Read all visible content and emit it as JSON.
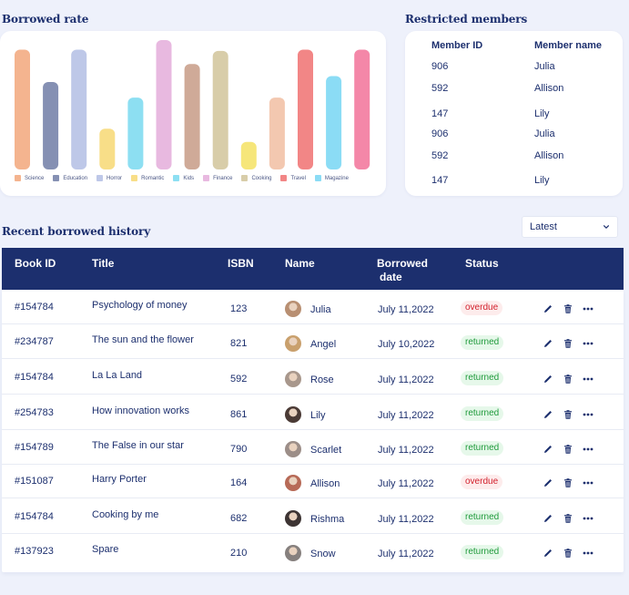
{
  "chart_section": {
    "title": "Borrowed rate"
  },
  "chart_data": {
    "type": "bar",
    "categories": [
      "Science",
      "Education",
      "Horror",
      "Romantic",
      "Kids",
      "Finance",
      "Cooking",
      "Travel",
      "Magazine"
    ],
    "values": [
      100,
      73,
      100,
      34,
      60,
      108,
      88,
      99,
      23,
      60,
      100,
      78,
      100
    ],
    "bar_colors": [
      "#f4b48f",
      "#8590b3",
      "#bec8e8",
      "#f8de88",
      "#8ddff2",
      "#e8b9e0",
      "#cfaa98",
      "#d8cda9",
      "#f6e67a",
      "#f3c8b0",
      "#f28686",
      "#8bdcf5",
      "#f487a8"
    ],
    "legend": [
      {
        "label": "Science",
        "color": "#f4b48f"
      },
      {
        "label": "Education",
        "color": "#8590b3"
      },
      {
        "label": "Horror",
        "color": "#bec8e8"
      },
      {
        "label": "Romantic",
        "color": "#f8de88"
      },
      {
        "label": "Kids",
        "color": "#8ddff2"
      },
      {
        "label": "Finance",
        "color": "#e8b9e0"
      },
      {
        "label": "Cooking",
        "color": "#d8cda9"
      },
      {
        "label": "Travel",
        "color": "#f28686"
      },
      {
        "label": "Magazine",
        "color": "#8bdcf5"
      }
    ],
    "ylim": [
      0,
      108
    ],
    "grid": false,
    "legend_position": "bottom"
  },
  "members": {
    "title": "Restricted members",
    "headers": [
      "Member ID",
      "Member name"
    ],
    "rows": [
      {
        "id": "906",
        "name": "Julia"
      },
      {
        "id": "592",
        "name": "Allison"
      },
      {
        "id": "147",
        "name": "Lily"
      },
      {
        "id": "906",
        "name": "Julia"
      },
      {
        "id": "592",
        "name": "Allison"
      },
      {
        "id": "147",
        "name": "Lily"
      }
    ]
  },
  "history": {
    "title": "Recent borrowed history",
    "sort": {
      "selected": "Latest"
    },
    "headers": {
      "book_id": "Book ID",
      "title": "Title",
      "isbn": "ISBN",
      "name": "Name",
      "borrowed_line1": "Borrowed",
      "borrowed_line2": "date",
      "status": "Status"
    },
    "rows": [
      {
        "book_id": "#154784",
        "title": "Psychology of money",
        "isbn": "123",
        "name": "Julia",
        "date": "July 11,2022",
        "status": "overdue",
        "avatar_color": "#b88f72"
      },
      {
        "book_id": "#234787",
        "title": "The sun and the flower",
        "isbn": "821",
        "name": "Angel",
        "date": "July 10,2022",
        "status": "returned",
        "avatar_color": "#c9a06d"
      },
      {
        "book_id": "#154784",
        "title": "La La Land",
        "isbn": "592",
        "name": "Rose",
        "date": "July 11,2022",
        "status": "returned",
        "avatar_color": "#a8978c"
      },
      {
        "book_id": "#254783",
        "title": "How innovation works",
        "isbn": "861",
        "name": "Lily",
        "date": "July 11,2022",
        "status": "returned",
        "avatar_color": "#4a3a35"
      },
      {
        "book_id": "#154789",
        "title": "The False in our star",
        "isbn": "790",
        "name": "Scarlet",
        "date": "July 11,2022",
        "status": "returned",
        "avatar_color": "#9c8e88"
      },
      {
        "book_id": "#151087",
        "title": "Harry Porter",
        "isbn": "164",
        "name": "Allison",
        "date": "July 11,2022",
        "status": "overdue",
        "avatar_color": "#b76a57"
      },
      {
        "book_id": "#154784",
        "title": "Cooking by me",
        "isbn": "682",
        "name": "Rishma",
        "date": "July 11,2022",
        "status": "returned",
        "avatar_color": "#3d3433"
      },
      {
        "book_id": "#137923",
        "title": "Spare",
        "isbn": "210",
        "name": "Snow",
        "date": "July 11,2022",
        "status": "returned",
        "avatar_color": "#86807e"
      }
    ]
  }
}
